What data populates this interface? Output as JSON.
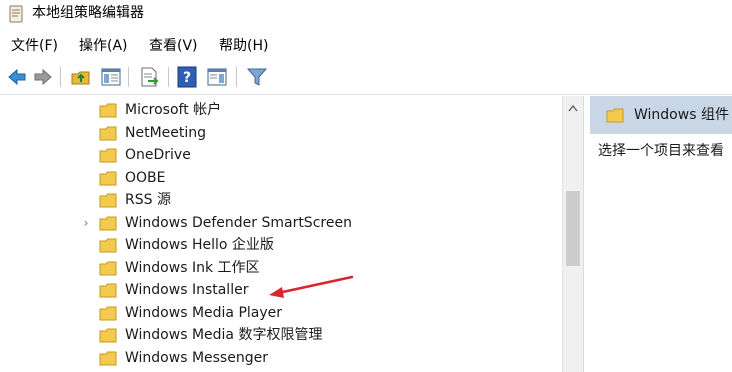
{
  "window": {
    "title": "本地组策略编辑器"
  },
  "menu": [
    {
      "label": "文件(F)"
    },
    {
      "label": "操作(A)"
    },
    {
      "label": "查看(V)"
    },
    {
      "label": "帮助(H)"
    }
  ],
  "toolbar": {
    "buttons": [
      {
        "icon": "back-arrow-icon"
      },
      {
        "icon": "forward-arrow-icon"
      },
      {
        "icon": "up-folder-icon"
      },
      {
        "icon": "show-hide-console-tree-icon"
      },
      {
        "icon": "export-list-icon"
      },
      {
        "icon": "help-icon"
      },
      {
        "icon": "show-hide-action-pane-icon"
      },
      {
        "icon": "filter-icon"
      }
    ]
  },
  "tree": {
    "items": [
      {
        "label": "Microsoft 帐户",
        "expandable": false
      },
      {
        "label": "NetMeeting",
        "expandable": false
      },
      {
        "label": "OneDrive",
        "expandable": false
      },
      {
        "label": "OOBE",
        "expandable": false
      },
      {
        "label": "RSS 源",
        "expandable": false
      },
      {
        "label": "Windows Defender SmartScreen",
        "expandable": true
      },
      {
        "label": "Windows Hello 企业版",
        "expandable": false
      },
      {
        "label": "Windows Ink 工作区",
        "expandable": false
      },
      {
        "label": "Windows Installer",
        "expandable": false,
        "annotated": true
      },
      {
        "label": "Windows Media Player",
        "expandable": false
      },
      {
        "label": "Windows Media 数字权限管理",
        "expandable": false
      },
      {
        "label": "Windows Messenger",
        "expandable": false
      }
    ]
  },
  "right_pane": {
    "header": "Windows 组件",
    "description": "选择一个项目来查看"
  },
  "colors": {
    "folder": "#f3c94e",
    "header_bg": "#c9d6e6",
    "annotation": "#d9262c"
  }
}
